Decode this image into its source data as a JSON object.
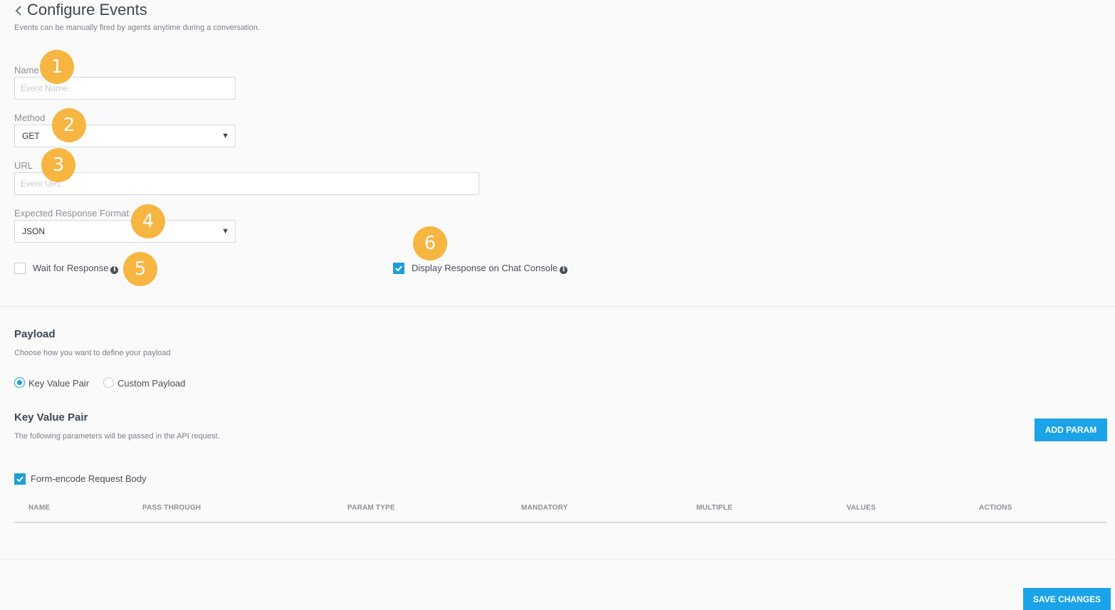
{
  "header": {
    "title": "Configure Events",
    "subtitle": "Events can be manually fired by agents anytime during a conversation."
  },
  "form": {
    "name": {
      "label": "Name",
      "placeholder": "Event Name",
      "value": ""
    },
    "method": {
      "label": "Method",
      "selected": "GET"
    },
    "url": {
      "label": "URL",
      "placeholder": "Event URL",
      "value": ""
    },
    "response_format": {
      "label": "Expected Response Format",
      "selected": "JSON"
    },
    "wait_for_response": {
      "label": "Wait for Response",
      "checked": false
    },
    "display_response": {
      "label": "Display Response on Chat Console",
      "checked": true
    }
  },
  "badges": [
    "1",
    "2",
    "3",
    "4",
    "5",
    "6"
  ],
  "payload": {
    "title": "Payload",
    "description": "Choose how you want to define your payload",
    "options": [
      {
        "label": "Key Value Pair",
        "selected": true
      },
      {
        "label": "Custom Payload",
        "selected": false
      }
    ]
  },
  "key_value": {
    "title": "Key Value Pair",
    "description": "The following parameters will be passed in the API request.",
    "add_button": "ADD PARAM",
    "form_encode": {
      "label": "Form-encode Request Body",
      "checked": true
    },
    "columns": [
      "NAME",
      "PASS THROUGH",
      "PARAM TYPE",
      "MANDATORY",
      "MULTIPLE",
      "VALUES",
      "ACTIONS"
    ]
  },
  "footer": {
    "save_button": "SAVE CHANGES"
  },
  "colors": {
    "accent": "#1aa3e8",
    "badge": "#f7b541"
  },
  "icons": {
    "back": "chevron-left-icon",
    "info": "info-icon",
    "check": "checkmark-icon",
    "caret": "caret-down-icon"
  }
}
